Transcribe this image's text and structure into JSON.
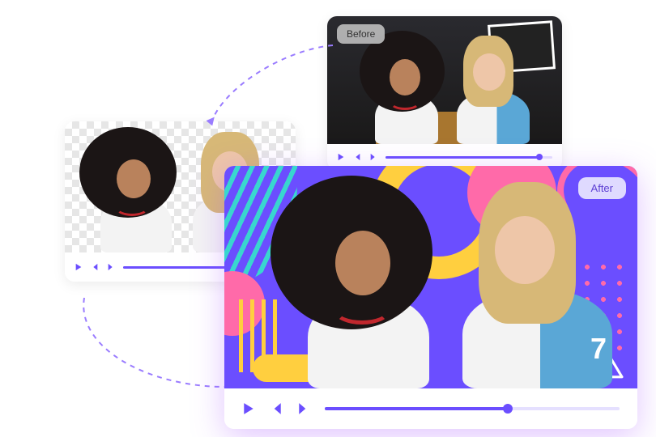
{
  "labels": {
    "before": "Before",
    "after": "After"
  },
  "players": {
    "before": {
      "progress_pct": 92
    },
    "mid": {
      "progress_pct": 95
    },
    "after": {
      "progress_pct": 62
    }
  },
  "after_jersey_number": "7",
  "colors": {
    "accent": "#6b4eff",
    "pink": "#ff6aa9",
    "yellow": "#ffcf3f",
    "cyan": "#39d6cf"
  }
}
